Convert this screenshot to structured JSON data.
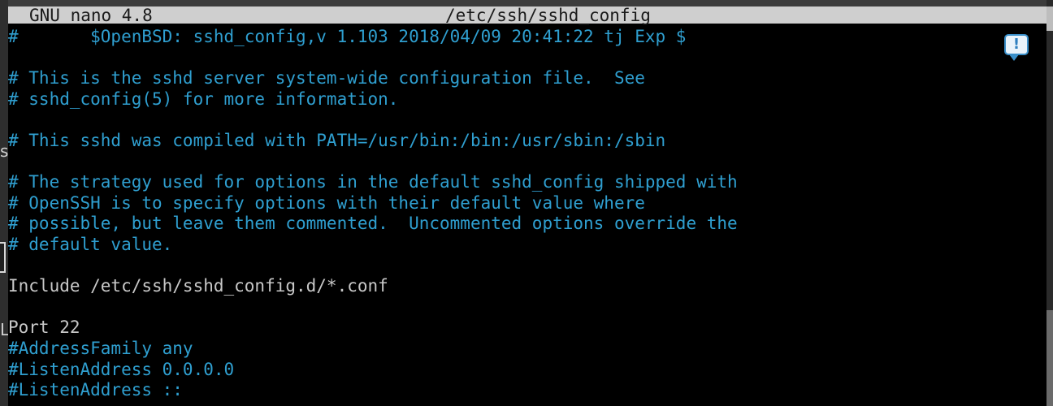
{
  "desktop": {
    "left_fragments": [
      "s",
      "L"
    ]
  },
  "titlebar": {
    "app": "GNU nano 4.8",
    "filename": "/etc/ssh/sshd_config"
  },
  "buffer": {
    "lines": [
      {
        "text": "#       $OpenBSD: sshd_config,v 1.103 2018/04/09 20:41:22 tj Exp $",
        "kind": "comment"
      },
      {
        "text": "",
        "kind": "plain"
      },
      {
        "text": "# This is the sshd server system-wide configuration file.  See",
        "kind": "comment"
      },
      {
        "text": "# sshd_config(5) for more information.",
        "kind": "comment"
      },
      {
        "text": "",
        "kind": "plain"
      },
      {
        "text": "# This sshd was compiled with PATH=/usr/bin:/bin:/usr/sbin:/sbin",
        "kind": "comment"
      },
      {
        "text": "",
        "kind": "plain"
      },
      {
        "text": "# The strategy used for options in the default sshd_config shipped with",
        "kind": "comment"
      },
      {
        "text": "# OpenSSH is to specify options with their default value where",
        "kind": "comment"
      },
      {
        "text": "# possible, but leave them commented.  Uncommented options override the",
        "kind": "comment"
      },
      {
        "text": "# default value.",
        "kind": "comment"
      },
      {
        "text": "",
        "kind": "plain"
      },
      {
        "text": "Include /etc/ssh/sshd_config.d/*.conf",
        "kind": "plain"
      },
      {
        "text": "",
        "kind": "plain"
      },
      {
        "text": "Port 22",
        "kind": "plain"
      },
      {
        "text": "#AddressFamily any",
        "kind": "comment"
      },
      {
        "text": "#ListenAddress 0.0.0.0",
        "kind": "comment"
      },
      {
        "text": "#ListenAddress ::",
        "kind": "comment"
      }
    ]
  },
  "notification": {
    "icon": "notification-icon",
    "glyph": "!"
  },
  "colors": {
    "background": "#000000",
    "titlebar_bg": "#cfcfcf",
    "titlebar_fg": "#1a1a1a",
    "comment": "#2f9fd0",
    "plain": "#c8c8c8"
  }
}
